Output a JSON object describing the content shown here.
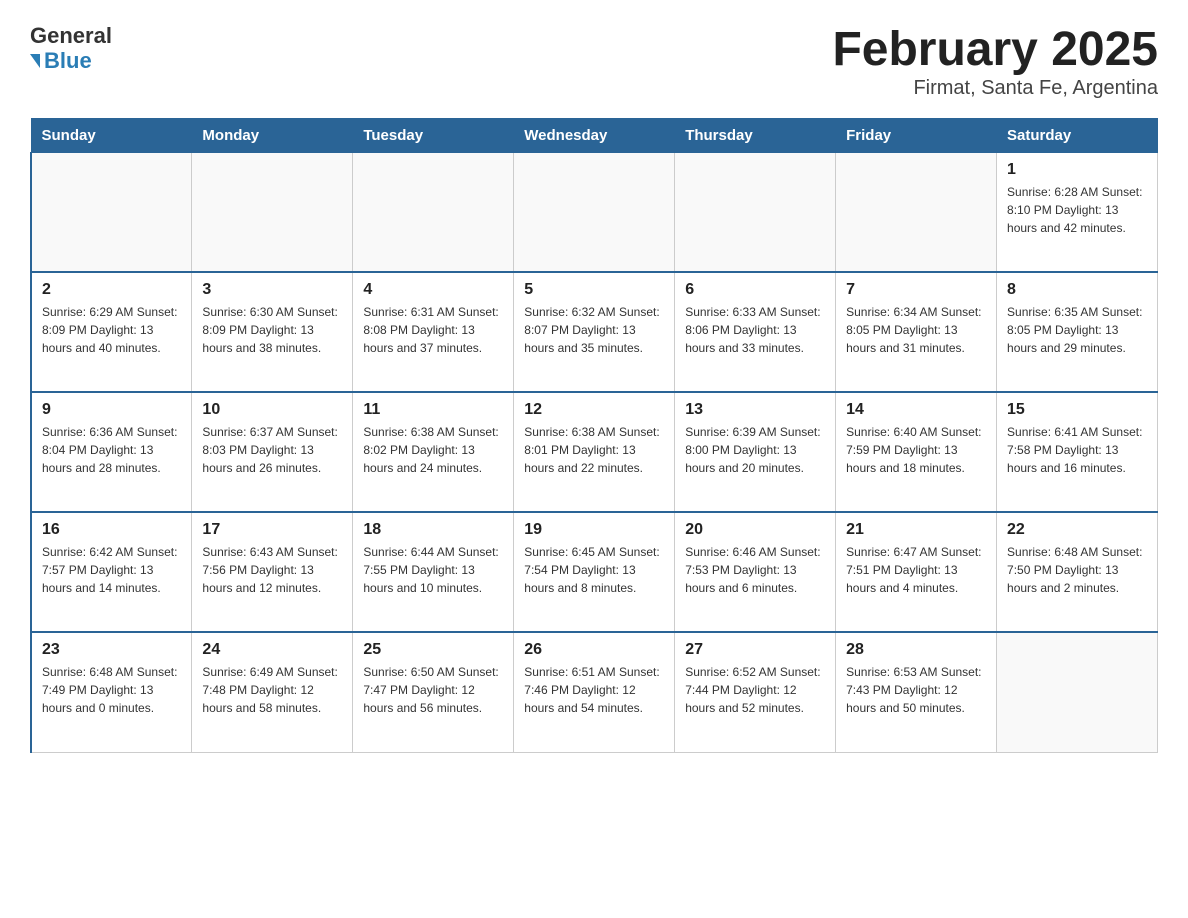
{
  "logo": {
    "general": "General",
    "blue": "Blue"
  },
  "title": "February 2025",
  "subtitle": "Firmat, Santa Fe, Argentina",
  "days_of_week": [
    "Sunday",
    "Monday",
    "Tuesday",
    "Wednesday",
    "Thursday",
    "Friday",
    "Saturday"
  ],
  "weeks": [
    [
      {
        "day": "",
        "info": ""
      },
      {
        "day": "",
        "info": ""
      },
      {
        "day": "",
        "info": ""
      },
      {
        "day": "",
        "info": ""
      },
      {
        "day": "",
        "info": ""
      },
      {
        "day": "",
        "info": ""
      },
      {
        "day": "1",
        "info": "Sunrise: 6:28 AM\nSunset: 8:10 PM\nDaylight: 13 hours and 42 minutes."
      }
    ],
    [
      {
        "day": "2",
        "info": "Sunrise: 6:29 AM\nSunset: 8:09 PM\nDaylight: 13 hours and 40 minutes."
      },
      {
        "day": "3",
        "info": "Sunrise: 6:30 AM\nSunset: 8:09 PM\nDaylight: 13 hours and 38 minutes."
      },
      {
        "day": "4",
        "info": "Sunrise: 6:31 AM\nSunset: 8:08 PM\nDaylight: 13 hours and 37 minutes."
      },
      {
        "day": "5",
        "info": "Sunrise: 6:32 AM\nSunset: 8:07 PM\nDaylight: 13 hours and 35 minutes."
      },
      {
        "day": "6",
        "info": "Sunrise: 6:33 AM\nSunset: 8:06 PM\nDaylight: 13 hours and 33 minutes."
      },
      {
        "day": "7",
        "info": "Sunrise: 6:34 AM\nSunset: 8:05 PM\nDaylight: 13 hours and 31 minutes."
      },
      {
        "day": "8",
        "info": "Sunrise: 6:35 AM\nSunset: 8:05 PM\nDaylight: 13 hours and 29 minutes."
      }
    ],
    [
      {
        "day": "9",
        "info": "Sunrise: 6:36 AM\nSunset: 8:04 PM\nDaylight: 13 hours and 28 minutes."
      },
      {
        "day": "10",
        "info": "Sunrise: 6:37 AM\nSunset: 8:03 PM\nDaylight: 13 hours and 26 minutes."
      },
      {
        "day": "11",
        "info": "Sunrise: 6:38 AM\nSunset: 8:02 PM\nDaylight: 13 hours and 24 minutes."
      },
      {
        "day": "12",
        "info": "Sunrise: 6:38 AM\nSunset: 8:01 PM\nDaylight: 13 hours and 22 minutes."
      },
      {
        "day": "13",
        "info": "Sunrise: 6:39 AM\nSunset: 8:00 PM\nDaylight: 13 hours and 20 minutes."
      },
      {
        "day": "14",
        "info": "Sunrise: 6:40 AM\nSunset: 7:59 PM\nDaylight: 13 hours and 18 minutes."
      },
      {
        "day": "15",
        "info": "Sunrise: 6:41 AM\nSunset: 7:58 PM\nDaylight: 13 hours and 16 minutes."
      }
    ],
    [
      {
        "day": "16",
        "info": "Sunrise: 6:42 AM\nSunset: 7:57 PM\nDaylight: 13 hours and 14 minutes."
      },
      {
        "day": "17",
        "info": "Sunrise: 6:43 AM\nSunset: 7:56 PM\nDaylight: 13 hours and 12 minutes."
      },
      {
        "day": "18",
        "info": "Sunrise: 6:44 AM\nSunset: 7:55 PM\nDaylight: 13 hours and 10 minutes."
      },
      {
        "day": "19",
        "info": "Sunrise: 6:45 AM\nSunset: 7:54 PM\nDaylight: 13 hours and 8 minutes."
      },
      {
        "day": "20",
        "info": "Sunrise: 6:46 AM\nSunset: 7:53 PM\nDaylight: 13 hours and 6 minutes."
      },
      {
        "day": "21",
        "info": "Sunrise: 6:47 AM\nSunset: 7:51 PM\nDaylight: 13 hours and 4 minutes."
      },
      {
        "day": "22",
        "info": "Sunrise: 6:48 AM\nSunset: 7:50 PM\nDaylight: 13 hours and 2 minutes."
      }
    ],
    [
      {
        "day": "23",
        "info": "Sunrise: 6:48 AM\nSunset: 7:49 PM\nDaylight: 13 hours and 0 minutes."
      },
      {
        "day": "24",
        "info": "Sunrise: 6:49 AM\nSunset: 7:48 PM\nDaylight: 12 hours and 58 minutes."
      },
      {
        "day": "25",
        "info": "Sunrise: 6:50 AM\nSunset: 7:47 PM\nDaylight: 12 hours and 56 minutes."
      },
      {
        "day": "26",
        "info": "Sunrise: 6:51 AM\nSunset: 7:46 PM\nDaylight: 12 hours and 54 minutes."
      },
      {
        "day": "27",
        "info": "Sunrise: 6:52 AM\nSunset: 7:44 PM\nDaylight: 12 hours and 52 minutes."
      },
      {
        "day": "28",
        "info": "Sunrise: 6:53 AM\nSunset: 7:43 PM\nDaylight: 12 hours and 50 minutes."
      },
      {
        "day": "",
        "info": ""
      }
    ]
  ]
}
